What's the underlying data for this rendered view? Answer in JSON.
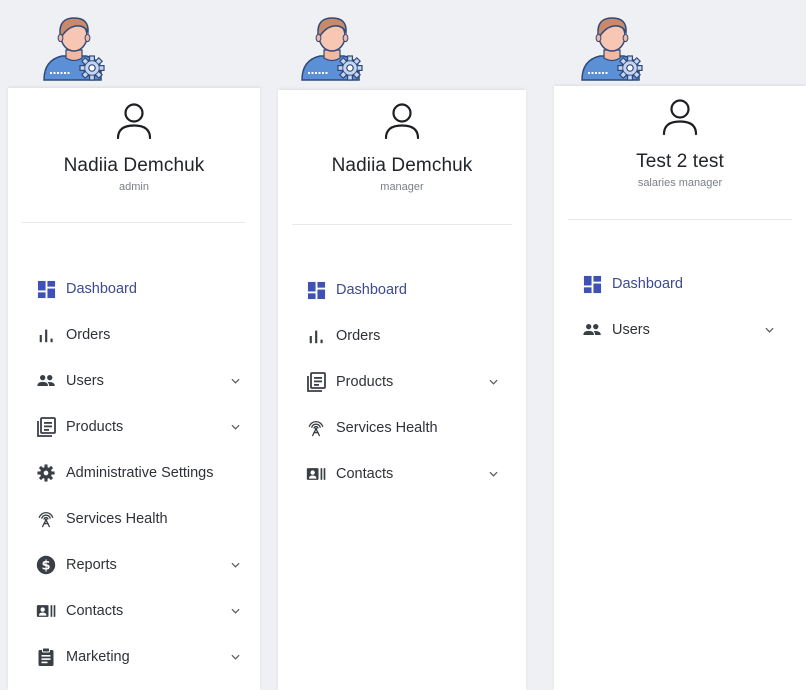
{
  "colors": {
    "sidebar_bg": "#ffffff",
    "page_bg": "#eef0f4",
    "active_text": "#3d4a8f",
    "active_icon": "#3f51b5",
    "text": "#2e3238",
    "icon": "#3a3f46"
  },
  "panels": [
    {
      "profile": {
        "name": "Nadiia Demchuk",
        "role": "admin"
      },
      "menu": [
        {
          "label": "Dashboard",
          "icon": "dashboard-icon",
          "active": true,
          "has_chevron": false
        },
        {
          "label": "Orders",
          "icon": "bar-chart-icon",
          "active": false,
          "has_chevron": false
        },
        {
          "label": "Users",
          "icon": "users-icon",
          "active": false,
          "has_chevron": true
        },
        {
          "label": "Products",
          "icon": "products-icon",
          "active": false,
          "has_chevron": true
        },
        {
          "label": "Administrative Settings",
          "icon": "gear-icon",
          "active": false,
          "has_chevron": false
        },
        {
          "label": "Services Health",
          "icon": "antenna-icon",
          "active": false,
          "has_chevron": false
        },
        {
          "label": "Reports",
          "icon": "dollar-icon",
          "active": false,
          "has_chevron": true
        },
        {
          "label": "Contacts",
          "icon": "contacts-icon",
          "active": false,
          "has_chevron": true
        },
        {
          "label": "Marketing",
          "icon": "document-icon",
          "active": false,
          "has_chevron": true
        }
      ]
    },
    {
      "profile": {
        "name": "Nadiia Demchuk",
        "role": "manager"
      },
      "menu": [
        {
          "label": "Dashboard",
          "icon": "dashboard-icon",
          "active": true,
          "has_chevron": false
        },
        {
          "label": "Orders",
          "icon": "bar-chart-icon",
          "active": false,
          "has_chevron": false
        },
        {
          "label": "Products",
          "icon": "products-icon",
          "active": false,
          "has_chevron": true
        },
        {
          "label": "Services Health",
          "icon": "antenna-icon",
          "active": false,
          "has_chevron": false
        },
        {
          "label": "Contacts",
          "icon": "contacts-icon",
          "active": false,
          "has_chevron": true
        }
      ]
    },
    {
      "profile": {
        "name": "Test 2 test",
        "role": "salaries manager"
      },
      "menu": [
        {
          "label": "Dashboard",
          "icon": "dashboard-icon",
          "active": true,
          "has_chevron": false
        },
        {
          "label": "Users",
          "icon": "users-icon",
          "active": false,
          "has_chevron": true
        }
      ]
    }
  ]
}
